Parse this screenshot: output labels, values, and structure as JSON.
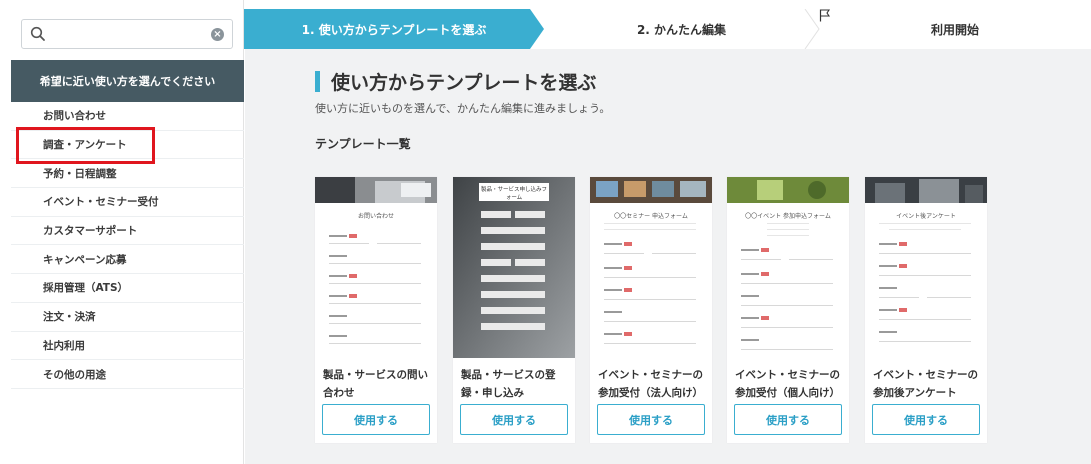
{
  "search": {
    "placeholder": "",
    "value": ""
  },
  "sidebar": {
    "header": "希望に近い使い方を選んでください",
    "items": [
      {
        "label": "お問い合わせ"
      },
      {
        "label": "調査・アンケート"
      },
      {
        "label": "予約・日程調整"
      },
      {
        "label": "イベント・セミナー受付"
      },
      {
        "label": "カスタマーサポート"
      },
      {
        "label": "キャンペーン応募"
      },
      {
        "label": "採用管理（ATS）"
      },
      {
        "label": "注文・決済"
      },
      {
        "label": "社内利用"
      },
      {
        "label": "その他の用途"
      }
    ]
  },
  "stepper": {
    "step1": "1. 使い方からテンプレートを選ぶ",
    "step2": "2. かんたん編集",
    "step3": "利用開始"
  },
  "main": {
    "title": "使い方からテンプレートを選ぶ",
    "subtitle": "使い方に近いものを選んで、かんたん編集に進みましょう。",
    "section": "テンプレート一覧"
  },
  "cards": [
    {
      "title": "製品・サービスの問い合わせ",
      "thumb_title": "お問い合わせ",
      "button": "使用する"
    },
    {
      "title": "製品・サービスの登録・申し込み",
      "thumb_title": "製品・サービス申し込みフォーム",
      "button": "使用する"
    },
    {
      "title": "イベント・セミナーの参加受付（法人向け）",
      "thumb_title": "〇〇セミナー 申込フォーム",
      "button": "使用する"
    },
    {
      "title": "イベント・セミナーの参加受付（個人向け）",
      "thumb_title": "〇〇イベント 参加申込フォーム",
      "button": "使用する"
    },
    {
      "title": "イベント・セミナーの参加後アンケート",
      "thumb_title": "イベント後アンケート",
      "button": "使用する"
    }
  ],
  "colors": {
    "accent": "#3aaed0",
    "sidebar_header": "#465a63",
    "highlight": "#e0161e"
  }
}
